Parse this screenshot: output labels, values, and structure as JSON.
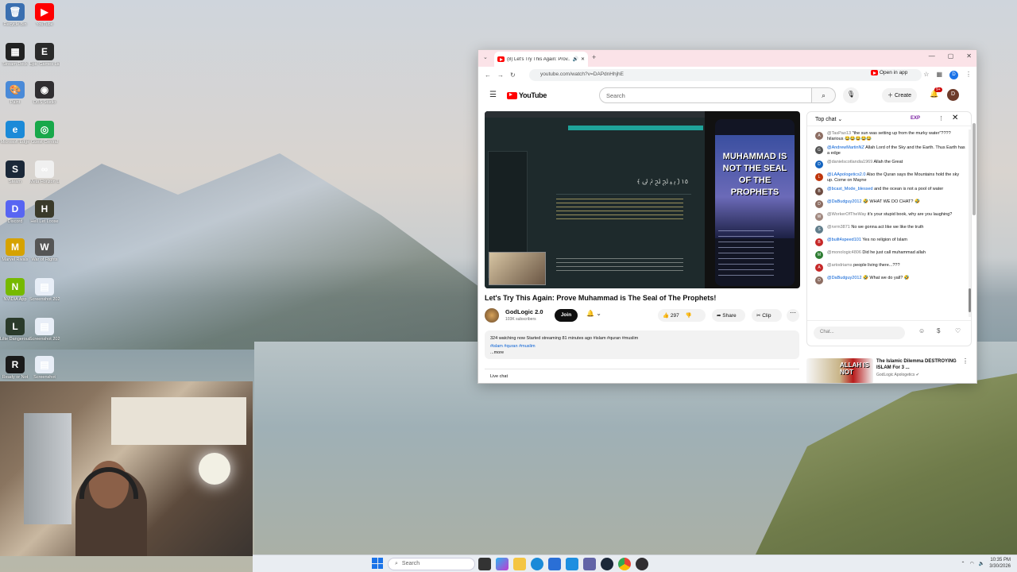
{
  "desktop": {
    "icons": [
      {
        "label": "Recycle Bin",
        "glyph": "🗑",
        "color": "#3a6fb0"
      },
      {
        "label": "YouTube",
        "glyph": "▶",
        "color": "#ff0000"
      },
      {
        "label": "Stream Deck",
        "glyph": "▦",
        "color": "#222222"
      },
      {
        "label": "Epic Games Launcher",
        "glyph": "E",
        "color": "#2a2a2a"
      },
      {
        "label": "Paint",
        "glyph": "🎨",
        "color": "#4a8ad8"
      },
      {
        "label": "OBS Studio",
        "glyph": "◉",
        "color": "#302e31"
      },
      {
        "label": "Microsoft Edge",
        "glyph": "e",
        "color": "#1b8ad8"
      },
      {
        "label": "Guest Central",
        "glyph": "◎",
        "color": "#18a84a"
      },
      {
        "label": "Steam",
        "glyph": "S",
        "color": "#1b2838"
      },
      {
        "label": "Meta Horizon Link",
        "glyph": "∞",
        "color": "#f0f0f0"
      },
      {
        "label": "Discord",
        "glyph": "D",
        "color": "#5865f2"
      },
      {
        "label": "Hell Let Loose",
        "glyph": "H",
        "color": "#3a3a2a"
      },
      {
        "label": "Marvel Rivals",
        "glyph": "M",
        "color": "#d6a200"
      },
      {
        "label": "War of Rights",
        "glyph": "W",
        "color": "#555555"
      },
      {
        "label": "NVIDIA App",
        "glyph": "N",
        "color": "#76b900"
      },
      {
        "label": "Screenshot 2026-01-...",
        "glyph": "▤",
        "color": "#e8eef7"
      },
      {
        "label": "Lilte Dangerous",
        "glyph": "L",
        "color": "#2a3a2a"
      },
      {
        "label": "Screenshot 2026-03-...",
        "glyph": "▤",
        "color": "#e8eef7"
      },
      {
        "label": "Ready or Not",
        "glyph": "R",
        "color": "#1a1a1a"
      },
      {
        "label": "Screenshot",
        "glyph": "▤",
        "color": "#e8eef7"
      }
    ]
  },
  "browser": {
    "tab_title": "(8) Let's Try This Again: Prov...",
    "url": "youtube.com/watch?v=DAPdnHhjhE",
    "open_in_app": "Open in app",
    "profile_initial": "D"
  },
  "youtube": {
    "logo": "YouTube",
    "search_placeholder": "Search",
    "create_label": "Create",
    "notif_count": "9+",
    "avatar_initial": "D"
  },
  "video": {
    "phone_overlay": "MUHAMMAD IS NOT THE SEAL OF THE PROPHETS",
    "title": "Let's Try This Again: Prove Muhammad is The Seal of The Prophets!",
    "channel": "GodLogic 2.0",
    "subscribers": "103K subscribers",
    "join_label": "Join",
    "likes": "297",
    "share_label": "Share",
    "clip_label": "Clip",
    "description_line": "324 watching now  Started streaming 81 minutes ago  #islam #quran #muslim",
    "hashtags": "#islam #quran #muslim",
    "more_label": "...more",
    "live_chat_label": "Live chat"
  },
  "chat": {
    "header": "Top chat",
    "xp": "EXP",
    "input_placeholder": "Chat...",
    "messages": [
      {
        "author": "@TasPao13",
        "text": "\"the sun was setting up from the murky water\"???? hilarious 😂😂😂😂😂",
        "color": "#8d6e63",
        "initial": "A",
        "gray": true
      },
      {
        "author": "@AndrewMartinNZ",
        "text": "Allah Lord of the Sky and the Earth. Thus Earth has a edge",
        "color": "#555555",
        "initial": "G",
        "gray": false
      },
      {
        "author": "@danielscotlandia1969",
        "text": "Allah the Great",
        "color": "#1565c0",
        "initial": "D",
        "gray": true
      },
      {
        "author": "@LAApologetics2.0",
        "text": "Also the Quran says the Mountains hold the sky up. Come on Mayne",
        "color": "#bf360c",
        "initial": "L",
        "gray": false
      },
      {
        "author": "@bcast_Mode_blessed",
        "text": "and the ocean is not a pool of water",
        "color": "#6d4c41",
        "initial": "B",
        "gray": false
      },
      {
        "author": "@DaBudguy2012",
        "text": "🤣 WHAT WE DO CHAT? 🤣",
        "color": "#8d6e63",
        "initial": "D",
        "gray": false
      },
      {
        "author": "@WorkerOfTheWay",
        "text": "it's your stupid book, why are you laughing?",
        "color": "#a1887f",
        "initial": "W",
        "gray": true
      },
      {
        "author": "@rvrm3871",
        "text": "No we gonna act like we like the truth",
        "color": "#607d8b",
        "initial": "S",
        "gray": true
      },
      {
        "author": "@built4speed101",
        "text": "Yes no religion of Islam",
        "color": "#c62828",
        "initial": "B",
        "gray": false
      },
      {
        "author": "@monologic4806",
        "text": "Did he just call muhammad allah",
        "color": "#2e7d32",
        "initial": "M",
        "gray": true
      },
      {
        "author": "@artodriams",
        "text": "people living there...???",
        "color": "#c62828",
        "initial": "A",
        "gray": true
      },
      {
        "author": "@DaBudguy2012",
        "text": "🤣 What we do yall? 🤣",
        "color": "#8d6e63",
        "initial": "D",
        "gray": false
      }
    ]
  },
  "recommendation": {
    "thumb_text": "ALLAH IS NOT",
    "title": "The Islamic Dilemma DESTROYING ISLAM For 3 ...",
    "channel": "GodLogic Apologetics"
  },
  "taskbar": {
    "search_placeholder": "Search",
    "time": "10:35 PM",
    "date": "3/30/2026"
  }
}
